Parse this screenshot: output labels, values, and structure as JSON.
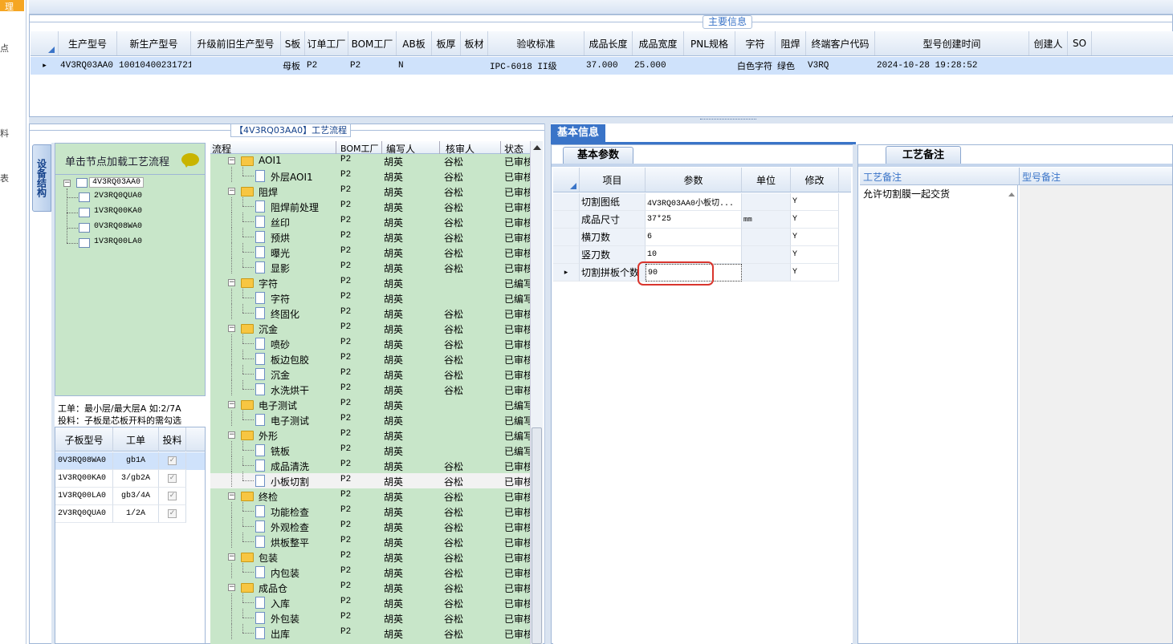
{
  "left_edge": {
    "items": [
      "理",
      "点",
      "料",
      "表"
    ]
  },
  "main_panel": {
    "title": "主要信息",
    "columns": [
      "生产型号",
      "新生产型号",
      "升级前旧生产型号",
      "S板",
      "订单工厂",
      "BOM工厂",
      "AB板",
      "板厚",
      "板材",
      "验收标准",
      "成品长度",
      "成品宽度",
      "PNL规格",
      "字符",
      "阻焊",
      "终端客户代码",
      "型号创建时间",
      "创建人",
      "SO"
    ],
    "row": {
      "marker": "▸",
      "values": [
        "4V3RQ03AA0",
        "10010400231721",
        "",
        "母板",
        "P2",
        "P2",
        "N",
        "",
        "",
        "IPC-6018 II级",
        "37.000",
        "25.000",
        "",
        "白色字符",
        "绿色",
        "V3RQ",
        "2024-10-28 19:28:52",
        "",
        ""
      ]
    }
  },
  "process_panel": {
    "title": "【4V3RQ03AA0】工艺流程",
    "side_tab": "设备结构",
    "load_hint": "单击节点加载工艺流程",
    "tree_root": "4V3RQ03AA0",
    "tree_children": [
      "2V3RQ0QUA0",
      "1V3RQ00KA0",
      "0V3RQ08WA0",
      "1V3RQ00LA0"
    ],
    "note1": "工单：最小层/最大层A 如:2/7A",
    "note2": "投料：子板是芯板开料的需勾选",
    "sub_table": {
      "headers": [
        "子板型号",
        "工单",
        "投料"
      ],
      "rows": [
        [
          "0V3RQ08WA0",
          "gb1A",
          "✓"
        ],
        [
          "1V3RQ00KA0",
          "3/gb2A",
          "✓"
        ],
        [
          "1V3RQ00LA0",
          "gb3/4A",
          "✓"
        ],
        [
          "2V3RQ0QUA0",
          "1/2A",
          "✓"
        ]
      ]
    },
    "flow_headers": [
      "流程",
      "BOM工厂",
      "编写人",
      "核审人",
      "状态"
    ],
    "flow_rows": [
      {
        "level": 1,
        "name": "AOI1",
        "bom": "P2",
        "writer": "胡英",
        "reviewer": "谷松",
        "status": "已审核"
      },
      {
        "level": 2,
        "name": "外层AOI1",
        "bom": "P2",
        "writer": "胡英",
        "reviewer": "谷松",
        "status": "已审核"
      },
      {
        "level": 1,
        "name": "阻焊",
        "bom": "P2",
        "writer": "胡英",
        "reviewer": "谷松",
        "status": "已审核"
      },
      {
        "level": 2,
        "name": "阻焊前处理",
        "bom": "P2",
        "writer": "胡英",
        "reviewer": "谷松",
        "status": "已审核"
      },
      {
        "level": 2,
        "name": "丝印",
        "bom": "P2",
        "writer": "胡英",
        "reviewer": "谷松",
        "status": "已审核"
      },
      {
        "level": 2,
        "name": "预烘",
        "bom": "P2",
        "writer": "胡英",
        "reviewer": "谷松",
        "status": "已审核"
      },
      {
        "level": 2,
        "name": "曝光",
        "bom": "P2",
        "writer": "胡英",
        "reviewer": "谷松",
        "status": "已审核"
      },
      {
        "level": 2,
        "name": "显影",
        "bom": "P2",
        "writer": "胡英",
        "reviewer": "谷松",
        "status": "已审核"
      },
      {
        "level": 1,
        "name": "字符",
        "bom": "P2",
        "writer": "胡英",
        "reviewer": "",
        "status": "已编写"
      },
      {
        "level": 2,
        "name": "字符",
        "bom": "P2",
        "writer": "胡英",
        "reviewer": "",
        "status": "已编写"
      },
      {
        "level": 2,
        "name": "终固化",
        "bom": "P2",
        "writer": "胡英",
        "reviewer": "谷松",
        "status": "已审核"
      },
      {
        "level": 1,
        "name": "沉金",
        "bom": "P2",
        "writer": "胡英",
        "reviewer": "谷松",
        "status": "已审核"
      },
      {
        "level": 2,
        "name": "喷砂",
        "bom": "P2",
        "writer": "胡英",
        "reviewer": "谷松",
        "status": "已审核"
      },
      {
        "level": 2,
        "name": "板边包胶",
        "bom": "P2",
        "writer": "胡英",
        "reviewer": "谷松",
        "status": "已审核"
      },
      {
        "level": 2,
        "name": "沉金",
        "bom": "P2",
        "writer": "胡英",
        "reviewer": "谷松",
        "status": "已审核"
      },
      {
        "level": 2,
        "name": "水洗烘干",
        "bom": "P2",
        "writer": "胡英",
        "reviewer": "谷松",
        "status": "已审核"
      },
      {
        "level": 1,
        "name": "电子测试",
        "bom": "P2",
        "writer": "胡英",
        "reviewer": "",
        "status": "已编写"
      },
      {
        "level": 2,
        "name": "电子测试",
        "bom": "P2",
        "writer": "胡英",
        "reviewer": "",
        "status": "已编写"
      },
      {
        "level": 1,
        "name": "外形",
        "bom": "P2",
        "writer": "胡英",
        "reviewer": "",
        "status": "已编写"
      },
      {
        "level": 2,
        "name": "铣板",
        "bom": "P2",
        "writer": "胡英",
        "reviewer": "",
        "status": "已编写"
      },
      {
        "level": 2,
        "name": "成品清洗",
        "bom": "P2",
        "writer": "胡英",
        "reviewer": "谷松",
        "status": "已审核"
      },
      {
        "level": 2,
        "name": "小板切割",
        "bom": "P2",
        "writer": "胡英",
        "reviewer": "谷松",
        "status": "已审核",
        "selected": true
      },
      {
        "level": 1,
        "name": "终检",
        "bom": "P2",
        "writer": "胡英",
        "reviewer": "谷松",
        "status": "已审核"
      },
      {
        "level": 2,
        "name": "功能检查",
        "bom": "P2",
        "writer": "胡英",
        "reviewer": "谷松",
        "status": "已审核"
      },
      {
        "level": 2,
        "name": "外观检查",
        "bom": "P2",
        "writer": "胡英",
        "reviewer": "谷松",
        "status": "已审核"
      },
      {
        "level": 2,
        "name": "烘板整平",
        "bom": "P2",
        "writer": "胡英",
        "reviewer": "谷松",
        "status": "已审核"
      },
      {
        "level": 1,
        "name": "包装",
        "bom": "P2",
        "writer": "胡英",
        "reviewer": "谷松",
        "status": "已审核"
      },
      {
        "level": 2,
        "name": "内包装",
        "bom": "P2",
        "writer": "胡英",
        "reviewer": "谷松",
        "status": "已审核"
      },
      {
        "level": 1,
        "name": "成品仓",
        "bom": "P2",
        "writer": "胡英",
        "reviewer": "谷松",
        "status": "已审核"
      },
      {
        "level": 2,
        "name": "入库",
        "bom": "P2",
        "writer": "胡英",
        "reviewer": "谷松",
        "status": "已审核"
      },
      {
        "level": 2,
        "name": "外包装",
        "bom": "P2",
        "writer": "胡英",
        "reviewer": "谷松",
        "status": "已审核"
      },
      {
        "level": 2,
        "name": "出库",
        "bom": "P2",
        "writer": "胡英",
        "reviewer": "谷松",
        "status": "已审核"
      }
    ]
  },
  "basic_info": {
    "tab": "基本信息",
    "subtab": "基本参数",
    "headers": [
      "项目",
      "参数",
      "单位",
      "修改"
    ],
    "rows": [
      {
        "item": "切割图纸",
        "param": "4V3RQ03AA0小板切...",
        "unit": "",
        "edit": "Y"
      },
      {
        "item": "成品尺寸",
        "param": "37*25",
        "unit": "mm",
        "edit": "Y"
      },
      {
        "item": "横刀数",
        "param": "6",
        "unit": "",
        "edit": "Y"
      },
      {
        "item": "竖刀数",
        "param": "10",
        "unit": "",
        "edit": "Y"
      },
      {
        "item": "切割拼板个数",
        "param": "90",
        "unit": "",
        "edit": "Y",
        "current": true
      }
    ]
  },
  "remark_panel": {
    "tab": "工艺备注",
    "col1_header": "工艺备注",
    "col2_header": "型号备注",
    "remark_text": "允许切割膜一起交货"
  },
  "colors": {
    "accent": "#3a74c8",
    "green_bg": "#c8e6c9",
    "header_bg": "#e4ecf7",
    "selected_row": "#cfe2fb"
  }
}
